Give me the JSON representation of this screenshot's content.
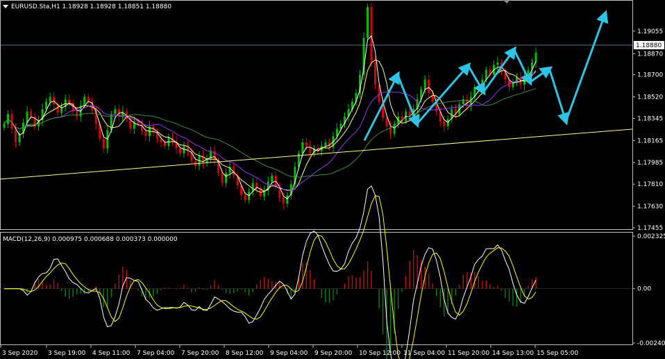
{
  "header": {
    "symbol_line": "EURUSD.Sta,H1  1.18928 1.18928 1.18851 1.18880",
    "macd_line": "MACD(12,26,9) 0.000975 0.000688 0.000373 0.000000"
  },
  "colors": {
    "background": "#000000",
    "frame": "#c0c0c0",
    "bull": "#00c000",
    "bear": "#e00000",
    "ma_fast": "#ffffff",
    "ma_mid": "#ffff80",
    "ma_slow_purple": "#9b30ff",
    "ma_long_green": "#3c8c3c",
    "trendline": "#ffff80",
    "arrows": "#2ec4e6",
    "macd_line": "#ffffff",
    "signal_line": "#ffff00",
    "hist_pos": "#c01010",
    "hist_neg": "#108010",
    "price_tag_bg": "#ffffff",
    "price_tag_text": "#000000"
  },
  "price_axis": {
    "labels": [
      "1.19055",
      "1.18870",
      "1.18700",
      "1.18520",
      "1.18345",
      "1.18165",
      "1.17985",
      "1.17810",
      "1.17630",
      "1.17455"
    ],
    "current_price": "1.18880"
  },
  "macd_axis": {
    "labels": [
      "0.002325",
      "0.00",
      "-0.002404"
    ]
  },
  "time_axis": {
    "labels": [
      "3 Sep 2020",
      "3 Sep 19:00",
      "4 Sep 11:00",
      "7 Sep 04:00",
      "7 Sep 20:00",
      "8 Sep 12:00",
      "9 Sep 04:00",
      "9 Sep 20:00",
      "10 Sep 12:00",
      "11 Sep 04:00",
      "11 Sep 20:00",
      "14 Sep 13:00",
      "15 Sep 05:00"
    ]
  },
  "chart_data": {
    "type": "candlestick",
    "symbol": "EURUSD.Sta",
    "timeframe": "H1",
    "ohlc_last": {
      "open": 1.18928,
      "high": 1.18928,
      "low": 1.18851,
      "close": 1.1888
    },
    "closes": [
      1.183,
      1.1838,
      1.1826,
      1.1815,
      1.1822,
      1.1831,
      1.184,
      1.1836,
      1.1828,
      1.1833,
      1.1842,
      1.1848,
      1.1852,
      1.1846,
      1.1839,
      1.1844,
      1.185,
      1.1847,
      1.184,
      1.1836,
      1.1845,
      1.1852,
      1.1848,
      1.1841,
      1.183,
      1.1818,
      1.181,
      1.1825,
      1.1838,
      1.1842,
      1.1836,
      1.184,
      1.1834,
      1.1826,
      1.1832,
      1.183,
      1.1824,
      1.182,
      1.1828,
      1.1823,
      1.1818,
      1.1815,
      1.1812,
      1.1819,
      1.1816,
      1.181,
      1.1806,
      1.1812,
      1.1808,
      1.18,
      1.1796,
      1.1804,
      1.1798,
      1.1802,
      1.1808,
      1.18,
      1.179,
      1.1782,
      1.179,
      1.1795,
      1.1788,
      1.178,
      1.1772,
      1.1768,
      1.1775,
      1.1782,
      1.1778,
      1.1771,
      1.1776,
      1.1783,
      1.1788,
      1.1779,
      1.177,
      1.1765,
      1.1772,
      1.1781,
      1.1795,
      1.1806,
      1.1815,
      1.1812,
      1.1806,
      1.181,
      1.1808,
      1.1812,
      1.1815,
      1.1811,
      1.182,
      1.1826,
      1.183,
      1.1836,
      1.1842,
      1.1848,
      1.1855,
      1.187,
      1.19,
      1.1925,
      1.188,
      1.1862,
      1.1848,
      1.1835,
      1.1828,
      1.1822,
      1.183,
      1.1836,
      1.1832,
      1.184,
      1.1836,
      1.1842,
      1.185,
      1.1858,
      1.1866,
      1.1855,
      1.1848,
      1.184,
      1.1832,
      1.1828,
      1.1834,
      1.1842,
      1.1838,
      1.1846,
      1.185,
      1.1845,
      1.1852,
      1.186,
      1.1858,
      1.1866,
      1.1874,
      1.187,
      1.1878,
      1.188,
      1.1872,
      1.1866,
      1.186,
      1.1864,
      1.1868,
      1.1862,
      1.1868,
      1.1874,
      1.188,
      1.1888
    ],
    "projection_arrows": [
      {
        "from": [
          1.18165,
          0.548
        ],
        "to": [
          1.187,
          0.598
        ]
      },
      {
        "from": [
          1.187,
          0.598
        ],
        "to": [
          1.183,
          0.627
        ]
      },
      {
        "from": [
          1.183,
          0.627
        ],
        "to": [
          1.18775,
          0.704
        ]
      },
      {
        "from": [
          1.18775,
          0.704
        ],
        "to": [
          1.1856,
          0.727
        ]
      },
      {
        "from": [
          1.1856,
          0.727
        ],
        "to": [
          1.18905,
          0.773
        ]
      },
      {
        "from": [
          1.18905,
          0.773
        ],
        "to": [
          1.1864,
          0.797
        ]
      },
      {
        "from": [
          1.1864,
          0.797
        ],
        "to": [
          1.1875,
          0.826
        ]
      },
      {
        "from": [
          1.1875,
          0.826
        ],
        "to": [
          1.1832,
          0.851
        ]
      },
      {
        "from": [
          1.1832,
          0.851
        ],
        "to": [
          1.19195,
          0.91
        ]
      }
    ],
    "macd": {
      "main": 0.000975,
      "signal": 0.000688,
      "histogram": 0.000373,
      "extra": 0.0
    },
    "price_ylim": [
      1.17455,
      1.19195
    ],
    "macd_ylim": [
      -0.002404,
      0.002325
    ]
  }
}
